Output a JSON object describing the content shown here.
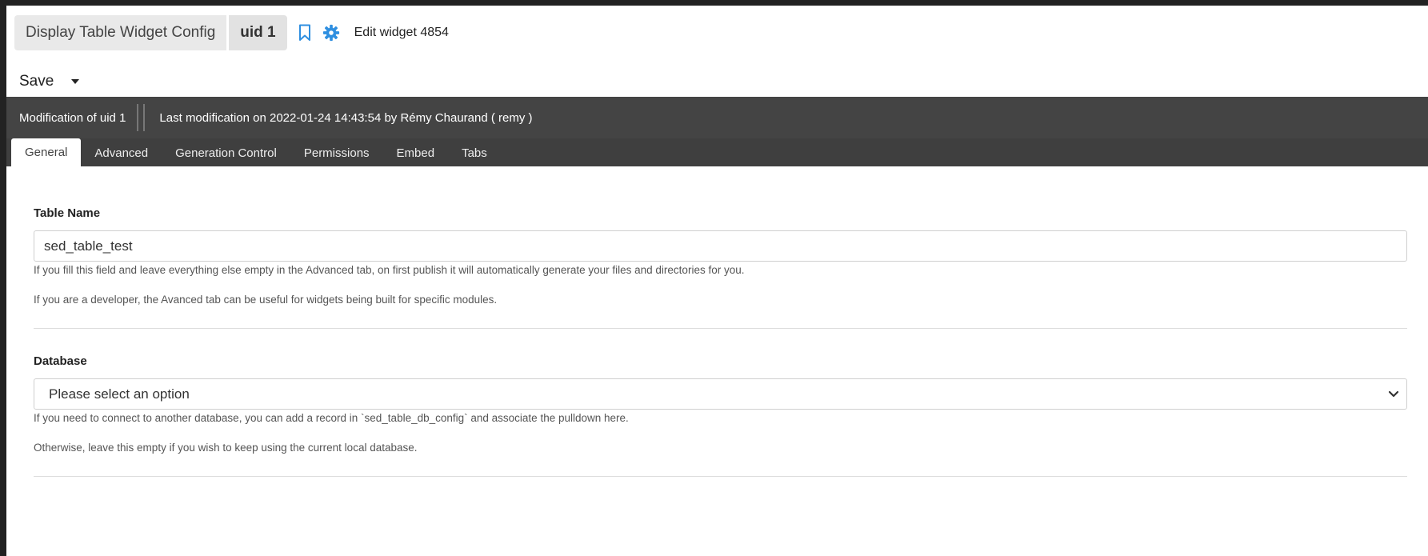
{
  "header": {
    "title": "Display Table Widget Config",
    "uid": "uid 1",
    "edit_label": "Edit widget 4854",
    "icons": {
      "bookmark": "bookmark-icon",
      "settings": "gear-icon"
    },
    "accent": "#2f8fe0"
  },
  "actions": {
    "save_label": "Save"
  },
  "info_bar": {
    "modification": "Modification of uid 1",
    "last_modification": "Last modification on 2022-01-24 14:43:54 by Rémy Chaurand ( remy )"
  },
  "tabs": [
    {
      "label": "General",
      "active": true
    },
    {
      "label": "Advanced"
    },
    {
      "label": "Generation Control"
    },
    {
      "label": "Permissions"
    },
    {
      "label": "Embed"
    },
    {
      "label": "Tabs"
    }
  ],
  "form": {
    "table_name": {
      "label": "Table Name",
      "value": "sed_table_test",
      "help1": "If you fill this field and leave everything else empty in the Advanced tab, on first publish it will automatically generate your files and directories for you.",
      "help2": "If you are a developer, the Avanced tab can be useful for widgets being built for specific modules."
    },
    "database": {
      "label": "Database",
      "selected": "Please select an option",
      "help1": "If you need to connect to another database, you can add a record in `sed_table_db_config` and associate the pulldown here.",
      "help2": "Otherwise, leave this empty if you wish to keep using the current local database."
    }
  }
}
